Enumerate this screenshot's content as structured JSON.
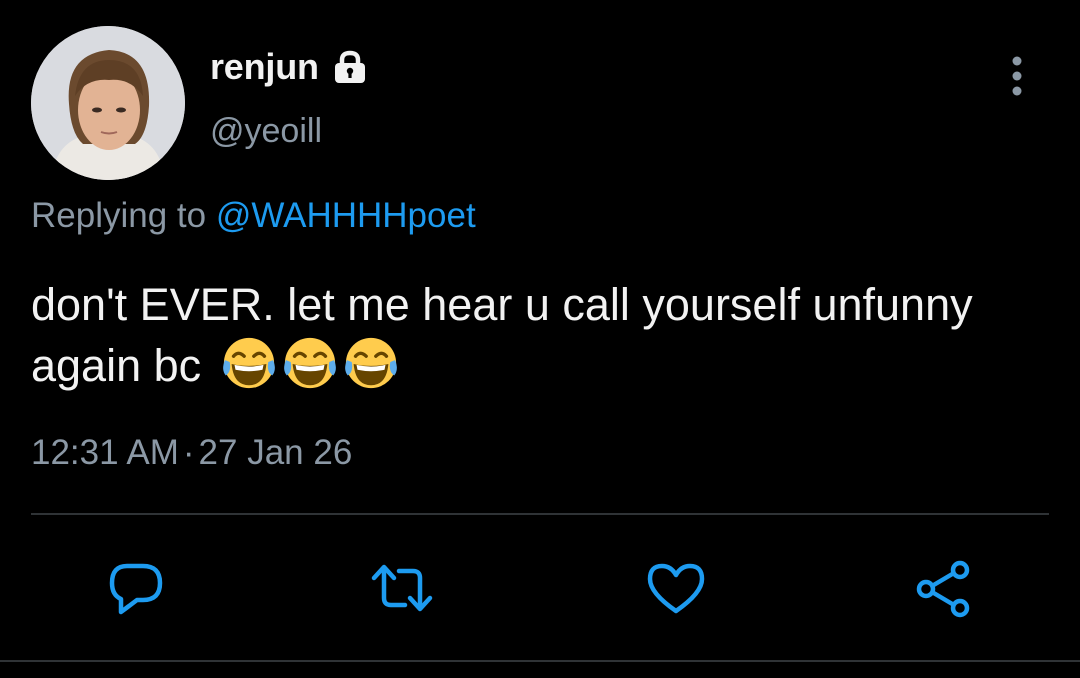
{
  "user": {
    "display_name": "renjun",
    "handle": "@yeoill",
    "protected_icon": "lock-icon"
  },
  "reply": {
    "prefix": "Replying to ",
    "mention": "@WAHHHHpoet"
  },
  "tweet": {
    "text": "don't EVER. let me hear u call yourself unfunny again bc",
    "emoji": [
      "😂",
      "😂",
      "😂"
    ]
  },
  "meta": {
    "time": "12:31 AM",
    "separator": "·",
    "date": "27 Jan 26"
  },
  "actions": [
    "reply-icon",
    "retweet-icon",
    "like-icon",
    "share-icon"
  ],
  "colors": {
    "background": "#000000",
    "text": "#f2f2f2",
    "secondary": "#8b98a5",
    "link": "#1d9bf0",
    "divider": "#2f3336"
  }
}
